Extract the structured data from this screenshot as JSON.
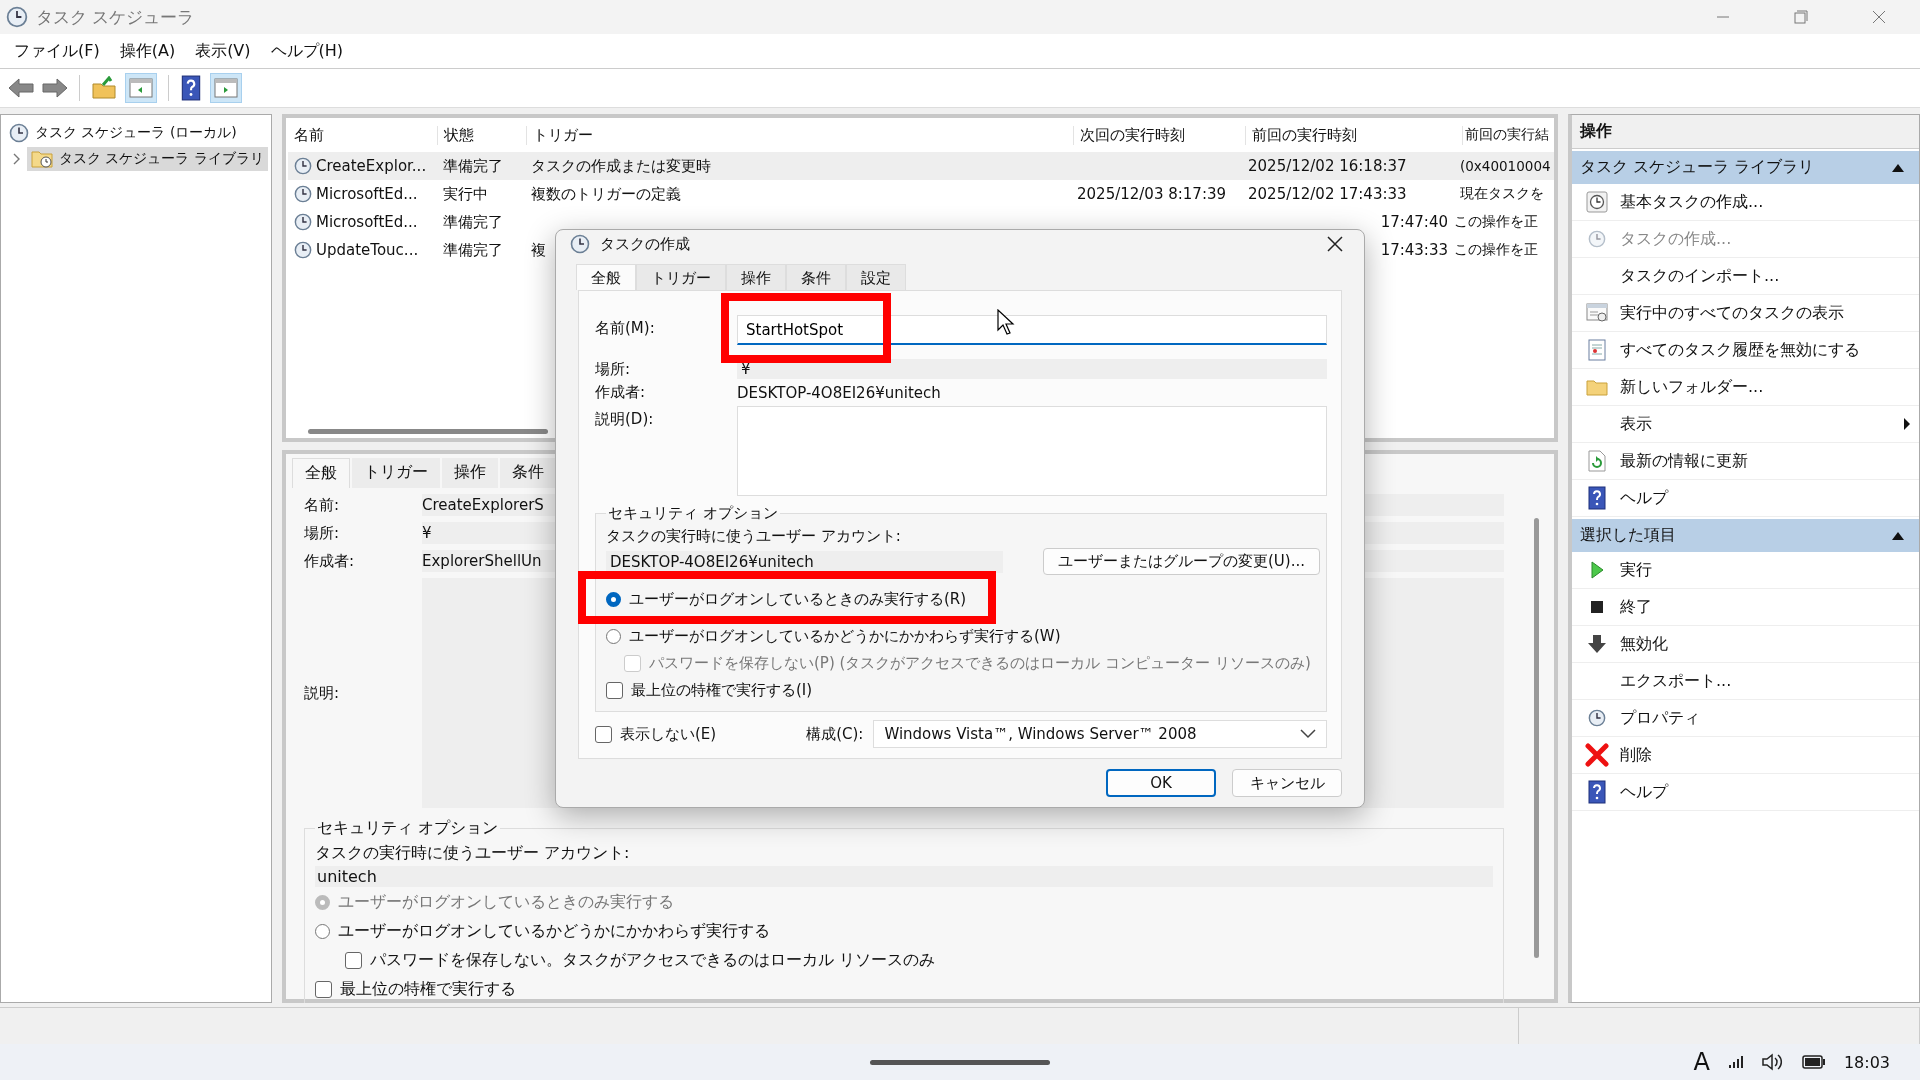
{
  "window": {
    "title": "タスク スケジューラ"
  },
  "menu": [
    "ファイル(F)",
    "操作(A)",
    "表示(V)",
    "ヘルプ(H)"
  ],
  "tree": [
    {
      "label": "タスク スケジューラ (ローカル)",
      "selected": false,
      "children": [
        {
          "label": "タスク スケジューラ ライブラリ",
          "selected": true,
          "expanded": false
        }
      ]
    }
  ],
  "task_table": {
    "columns": [
      "名前",
      "状態",
      "トリガー",
      "次回の実行時刻",
      "前回の実行時刻",
      "前回の実行結"
    ],
    "rows": [
      {
        "selected": true,
        "cells": [
          "CreateExplor...",
          "準備完了",
          "タスクの作成または変更時",
          null,
          "2025/12/02 16:18:37",
          "(0x40010004"
        ]
      },
      {
        "selected": false,
        "cells": [
          "MicrosoftEd...",
          "実行中",
          "複数のトリガーの定義",
          "2025/12/03 8:17:39",
          "2025/12/02 17:43:33",
          "現在タスクを"
        ]
      },
      {
        "selected": false,
        "cells": [
          "MicrosoftEd...",
          "準備完了",
          null,
          null,
          "17:47:40",
          "この操作を正"
        ]
      },
      {
        "selected": false,
        "cells": [
          "UpdateTouc...",
          "準備完了",
          "複",
          null,
          "17:43:33",
          "この操作を正"
        ]
      }
    ]
  },
  "detail_panel": {
    "tabs": [
      {
        "label": "全般",
        "selected": true
      },
      {
        "label": "トリガー",
        "selected": false
      },
      {
        "label": "操作",
        "selected": false
      },
      {
        "label": "条件",
        "selected": false
      }
    ],
    "fields": [
      {
        "label": "名前:",
        "value": "CreateExplorerS"
      },
      {
        "label": "場所:",
        "value": "¥"
      },
      {
        "label": "作成者:",
        "value": "ExplorerShellUn"
      }
    ],
    "description_label": "説明:",
    "security": {
      "title": "セキュリティ オプション",
      "account_label": "タスクの実行時に使うユーザー アカウント:",
      "account": "unitech",
      "options": [
        {
          "kind": "radio",
          "label": "ユーザーがログオンしているときのみ実行する",
          "selected": true,
          "disabled": true
        },
        {
          "kind": "radio",
          "label": "ユーザーがログオンしているかどうかにかかわらず実行する",
          "selected": false,
          "disabled": false
        },
        {
          "kind": "sub-checkbox",
          "label": "パスワードを保存しない。タスクがアクセスできるのはローカル リソースのみ",
          "checked": false,
          "disabled": false
        },
        {
          "kind": "checkbox",
          "label": "最上位の特権で実行する",
          "checked": false,
          "disabled": false
        }
      ]
    }
  },
  "dialog": {
    "title": "タスクの作成",
    "tabs": [
      {
        "label": "全般",
        "selected": true
      },
      {
        "label": "トリガー",
        "selected": false
      },
      {
        "label": "操作",
        "selected": false
      },
      {
        "label": "条件",
        "selected": false
      },
      {
        "label": "設定",
        "selected": false
      }
    ],
    "name": {
      "label": "名前(M):",
      "value": "StartHotSpot",
      "highlight": true
    },
    "location": {
      "label": "場所:",
      "value": "¥"
    },
    "author": {
      "label": "作成者:",
      "value": "DESKTOP-4O8EI26¥unitech"
    },
    "description": {
      "label": "説明(D):"
    },
    "security": {
      "title": "セキュリティ オプション",
      "account_label": "タスクの実行時に使うユーザー アカウント:",
      "account": "DESKTOP-4O8EI26¥unitech",
      "change_button": "ユーザーまたはグループの変更(U)...",
      "options": [
        {
          "kind": "radio",
          "label": "ユーザーがログオンしているときのみ実行する(R)",
          "selected": true,
          "disabled": false,
          "highlight": true
        },
        {
          "kind": "radio",
          "label": "ユーザーがログオンしているかどうかにかかわらず実行する(W)",
          "selected": false,
          "disabled": false,
          "highlight": false
        },
        {
          "kind": "sub-checkbox",
          "label": "パスワードを保存しない(P) (タスクがアクセスできるのはローカル コンピューター リソースのみ)",
          "checked": false,
          "disabled": true,
          "highlight": false
        },
        {
          "kind": "checkbox",
          "label": "最上位の特権で実行する(I)",
          "checked": false,
          "disabled": false,
          "highlight": false
        }
      ]
    },
    "hidden": {
      "label": "表示しない(E)",
      "checked": false
    },
    "config": {
      "label": "構成(C):",
      "value": "Windows Vista™, Windows Server™ 2008"
    },
    "buttons": [
      "OK",
      "キャンセル"
    ]
  },
  "actions_pane": {
    "title": "操作",
    "sections": [
      {
        "title": "タスク スケジューラ ライブラリ",
        "expanded": true,
        "items": [
          {
            "kind": "basic-task",
            "label": "基本タスクの作成...",
            "disabled": false
          },
          {
            "kind": "create-task",
            "label": "タスクの作成...",
            "disabled": true
          },
          {
            "kind": "plain",
            "label": "タスクのインポート...",
            "disabled": false
          },
          {
            "kind": "running",
            "label": "実行中のすべてのタスクの表示",
            "disabled": false
          },
          {
            "kind": "history",
            "label": "すべてのタスク履歴を無効にする",
            "disabled": false
          },
          {
            "kind": "folder",
            "label": "新しいフォルダー...",
            "disabled": false
          },
          {
            "kind": "submenu",
            "label": "表示",
            "disabled": false
          },
          {
            "kind": "refresh",
            "label": "最新の情報に更新",
            "disabled": false
          },
          {
            "kind": "help",
            "label": "ヘルプ",
            "disabled": false
          }
        ]
      },
      {
        "title": "選択した項目",
        "expanded": true,
        "items": [
          {
            "kind": "run",
            "label": "実行",
            "disabled": false
          },
          {
            "kind": "stop",
            "label": "終了",
            "disabled": false
          },
          {
            "kind": "disable",
            "label": "無効化",
            "disabled": false
          },
          {
            "kind": "plain",
            "label": "エクスポート...",
            "disabled": false
          },
          {
            "kind": "properties",
            "label": "プロパティ",
            "disabled": false
          },
          {
            "kind": "delete",
            "label": "削除",
            "disabled": false
          },
          {
            "kind": "help",
            "label": "ヘルプ",
            "disabled": false
          }
        ]
      }
    ]
  },
  "taskbar": {
    "ime": "A",
    "time": "18:03"
  }
}
